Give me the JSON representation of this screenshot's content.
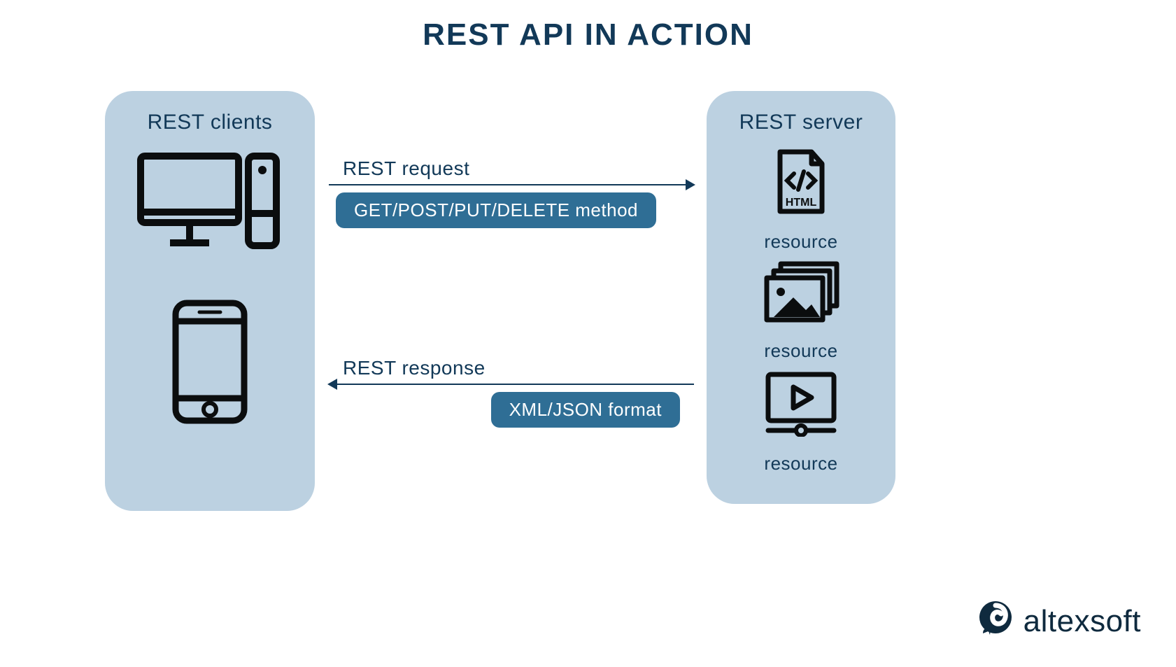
{
  "title": "REST API IN ACTION",
  "clients": {
    "title": "REST clients"
  },
  "server": {
    "title": "REST server",
    "resource_label": "resource",
    "html_icon_text": "HTML"
  },
  "request": {
    "label": "REST request",
    "pill": "GET/POST/PUT/DELETE method"
  },
  "response": {
    "label": "REST response",
    "pill": "XML/JSON format"
  },
  "brand": {
    "name": "altexsoft"
  },
  "colors": {
    "panel_bg": "#bcd1e1",
    "text_dark": "#123958",
    "pill_bg": "#2f6e95",
    "icon_black": "#0b0d0e"
  }
}
